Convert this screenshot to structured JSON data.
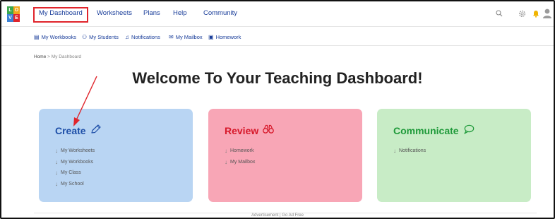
{
  "logo": {
    "letters": [
      "L",
      "O",
      "V",
      "E"
    ],
    "colors": [
      "#3aa84d",
      "#f2a51a",
      "#3b82d6",
      "#e0242b"
    ]
  },
  "topnav": {
    "items": [
      {
        "label": "My Dashboard"
      },
      {
        "label": "Worksheets"
      },
      {
        "label": "Plans"
      },
      {
        "label": "Help"
      },
      {
        "label": "Community"
      }
    ],
    "active_highlight_color": "#e0242b",
    "right_icons": [
      "search-icon",
      "gear-icon",
      "bell-icon",
      "user-avatar-icon"
    ]
  },
  "subnav": {
    "items": [
      {
        "label": "My Workbooks",
        "icon": "book-icon"
      },
      {
        "label": "My Students",
        "icon": "students-icon"
      },
      {
        "label": "Notifications",
        "icon": "bell-icon"
      },
      {
        "label": "My Mailbox",
        "icon": "mail-icon"
      },
      {
        "label": "Homework",
        "icon": "document-icon"
      }
    ]
  },
  "breadcrumb": {
    "home": "Home",
    "separator": ">",
    "current": "My Dashboard"
  },
  "page_title": "Welcome To Your Teaching Dashboard!",
  "cards": [
    {
      "title": "Create",
      "title_color": "#1e4fa8",
      "background": "#b9d5f3",
      "icon": "pencil-icon",
      "links": [
        "My Worksheets",
        "My Workbooks",
        "My Class",
        "My School"
      ]
    },
    {
      "title": "Review",
      "title_color": "#d7182a",
      "background": "#f8a6b6",
      "icon": "binoculars-icon",
      "links": [
        "Homework",
        "My Mailbox"
      ]
    },
    {
      "title": "Communicate",
      "title_color": "#1f9a3a",
      "background": "#c8ecc6",
      "icon": "speech-bubble-icon",
      "links": [
        "Notifications"
      ]
    }
  ],
  "link_arrow_glyph": "↓",
  "footer": {
    "ad_text": "Advertisement | Go Ad Free"
  },
  "annotation_color": "#e0242b"
}
